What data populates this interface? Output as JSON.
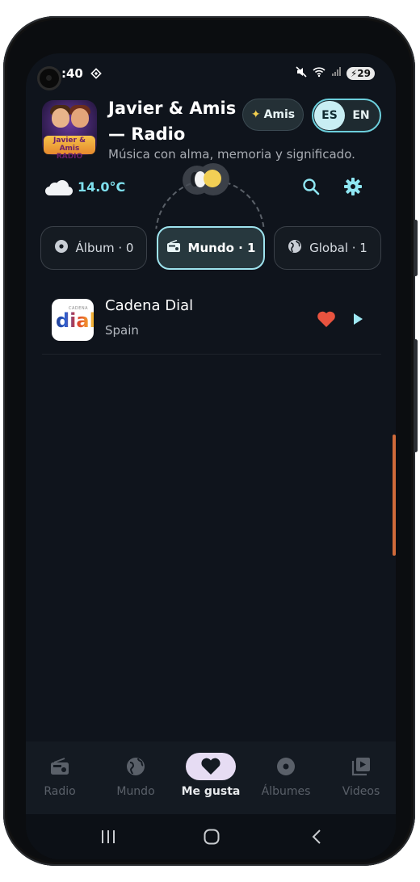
{
  "status_bar": {
    "time": ":40",
    "battery": "29"
  },
  "header": {
    "logo_text_line1": "Javier & Amis",
    "logo_text_line2": "RADIO",
    "title": "Javier & Amis — Radio",
    "subtitle": "Música con alma, memoria y significado.",
    "amis_button_label": "Amis",
    "languages": [
      "ES",
      "EN"
    ],
    "active_language": "ES"
  },
  "weather": {
    "temperature": "14.0°C",
    "icon": "cloud-icon"
  },
  "chips": [
    {
      "label": "Álbum · 0",
      "icon": "disc-icon",
      "active": false
    },
    {
      "label": "Mundo · 1",
      "icon": "radio-icon",
      "active": true
    },
    {
      "label": "Global · 1",
      "icon": "globe-icon",
      "active": false
    }
  ],
  "stations": [
    {
      "logo_small": "CADENA",
      "logo_text": "dial",
      "name": "Cadena Dial",
      "country": "Spain",
      "favorite": true
    }
  ],
  "bottom_nav": [
    {
      "label": "Radio",
      "icon": "radio-icon",
      "active": false
    },
    {
      "label": "Mundo",
      "icon": "globe-icon",
      "active": false
    },
    {
      "label": "Me gusta",
      "icon": "heart-icon",
      "active": true
    },
    {
      "label": "Álbumes",
      "icon": "disc-icon",
      "active": false
    },
    {
      "label": "Videos",
      "icon": "video-library-icon",
      "active": false
    }
  ],
  "colors": {
    "accent": "#9ee3ee",
    "heart": "#e8533f",
    "background": "#0f141c"
  }
}
